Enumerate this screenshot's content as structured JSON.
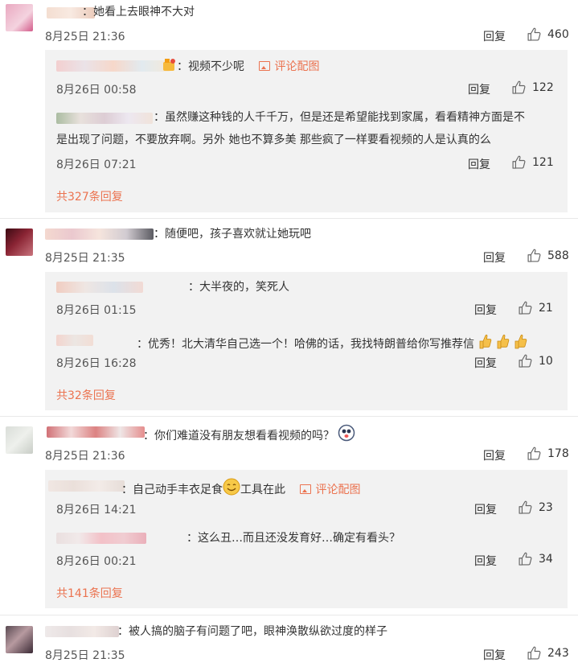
{
  "comments": [
    {
      "text": "：她看上去眼神不大对",
      "date": "8月25日 21:36",
      "reply_label": "回复",
      "likes": "460",
      "replies": [
        {
          "text": "：视频不少呢",
          "pic_link": "评论配图",
          "date": "8月26日 00:58",
          "reply_label": "回复",
          "likes": "122"
        },
        {
          "text_line1": "：虽然赚这种钱的人千千万，但是还是希望能找到家属，看看精神方面是不",
          "text_line2": "是出现了问题，不要放弃啊。另外 她也不算多美 那些疯了一样要看视频的人是认真的么",
          "date": "8月26日 07:21",
          "reply_label": "回复",
          "likes": "121"
        }
      ],
      "more_replies": "共327条回复"
    },
    {
      "text": "：随便吧，孩子喜欢就让她玩吧",
      "date": "8月25日 21:35",
      "reply_label": "回复",
      "likes": "588",
      "replies": [
        {
          "text": "：大半夜的，笑死人",
          "date": "8月26日 01:15",
          "reply_label": "回复",
          "likes": "21"
        },
        {
          "text": "：优秀！北大清华自己选一个！哈佛的话，我找特朗普给你写推荐信",
          "date": "8月26日 16:28",
          "reply_label": "回复",
          "likes": "10"
        }
      ],
      "more_replies": "共32条回复"
    },
    {
      "text": "：你们难道没有朋友想看看视频的吗？",
      "date": "8月25日 21:36",
      "reply_label": "回复",
      "likes": "178",
      "replies": [
        {
          "text_a": "：自己动手丰衣足食",
          "text_b": "工具在此",
          "pic_link": "评论配图",
          "date": "8月26日 14:21",
          "reply_label": "回复",
          "likes": "23"
        },
        {
          "text": "：这么丑…而且还没发育好…确定有看头？",
          "date": "8月26日 00:21",
          "reply_label": "回复",
          "likes": "34"
        }
      ],
      "more_replies": "共141条回复"
    },
    {
      "text": "：被人搞的脑子有问题了吧，眼神涣散纵欲过度的样子",
      "date": "8月25日 21:35",
      "reply_label": "回复",
      "likes": "243"
    }
  ],
  "colors": {
    "link": "#eb7350",
    "sub_bg": "#f2f2f2",
    "text": "#333333"
  },
  "icons": {
    "like": "thumbs-up-icon",
    "pic": "image-icon"
  }
}
